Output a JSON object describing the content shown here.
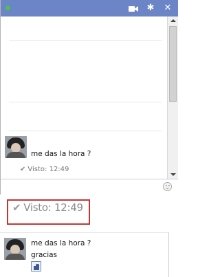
{
  "chat_window": {
    "online_status": "online",
    "icons": [
      "video-call-icon",
      "gear-icon",
      "close-icon"
    ],
    "messages": [
      {
        "text": "me das la hora ?"
      }
    ],
    "seen_label": "Visto: 12:49",
    "input": {
      "value": "",
      "placeholder": ""
    }
  },
  "zoom_callout": {
    "seen_label": "Visto: 12:49",
    "border_color": "#c43535"
  },
  "second_panel": {
    "messages": [
      {
        "text": "me das la hora ?"
      },
      {
        "text": "gracias"
      }
    ],
    "reaction": "like-icon"
  },
  "colors": {
    "titlebar": "#6b85c6",
    "online_dot": "#4cc14c",
    "like_blue": "#3b5998"
  }
}
